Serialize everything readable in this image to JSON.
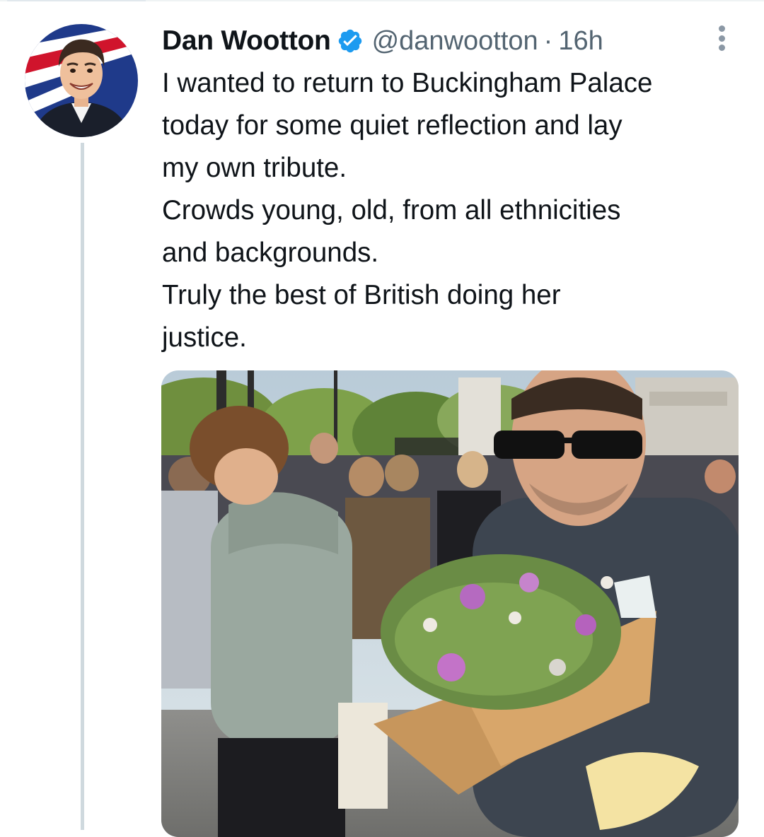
{
  "tweet": {
    "author": {
      "display_name": "Dan Wootton",
      "handle": "@danwootton",
      "verified": true,
      "avatar_icon": "profile-photo"
    },
    "separator": "·",
    "timestamp": "16h",
    "text_lines": [
      "I wanted to return to Buckingham Palace",
      "today for some quiet reflection and lay",
      "my own tribute.",
      "Crowds young, old, from all ethnicities",
      "and backgrounds.",
      "Truly the best of British doing her",
      "justice."
    ],
    "media": {
      "type": "photo"
    }
  },
  "icons": {
    "verified": "verified-badge-icon",
    "more": "more-options-icon"
  },
  "colors": {
    "text_primary": "#0f1419",
    "text_secondary": "#536471",
    "verified_blue": "#1d9bf0",
    "thread_line": "#cfd9de"
  }
}
